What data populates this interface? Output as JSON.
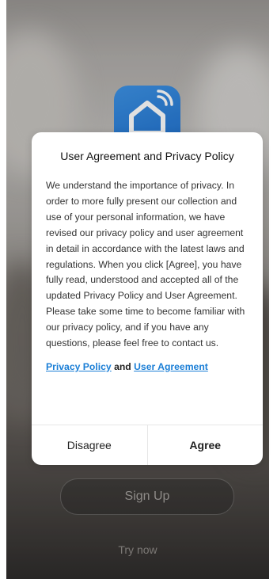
{
  "dialog": {
    "title": "User Agreement and Privacy Policy",
    "body": "We understand the importance of privacy. In order to more fully present our collection and use of your personal information, we have revised our privacy policy and user agreement in detail in accordance with the latest laws and regulations. When you click [Agree], you have fully read, understood and accepted all of the updated Privacy Policy and User Agreement. Please take some time to become familiar with our privacy policy, and if you have any questions, please feel free to contact us.",
    "privacy_link": "Privacy Policy",
    "conjunction": "and",
    "agreement_link": "User Agreement",
    "disagree_label": "Disagree",
    "agree_label": "Agree"
  },
  "background": {
    "signup_label": "Sign Up",
    "try_now_label": "Try now",
    "app_icon": "smart-home-wifi-icon"
  },
  "colors": {
    "link": "#1a7ed6",
    "app_icon": "#2a7fd8"
  }
}
